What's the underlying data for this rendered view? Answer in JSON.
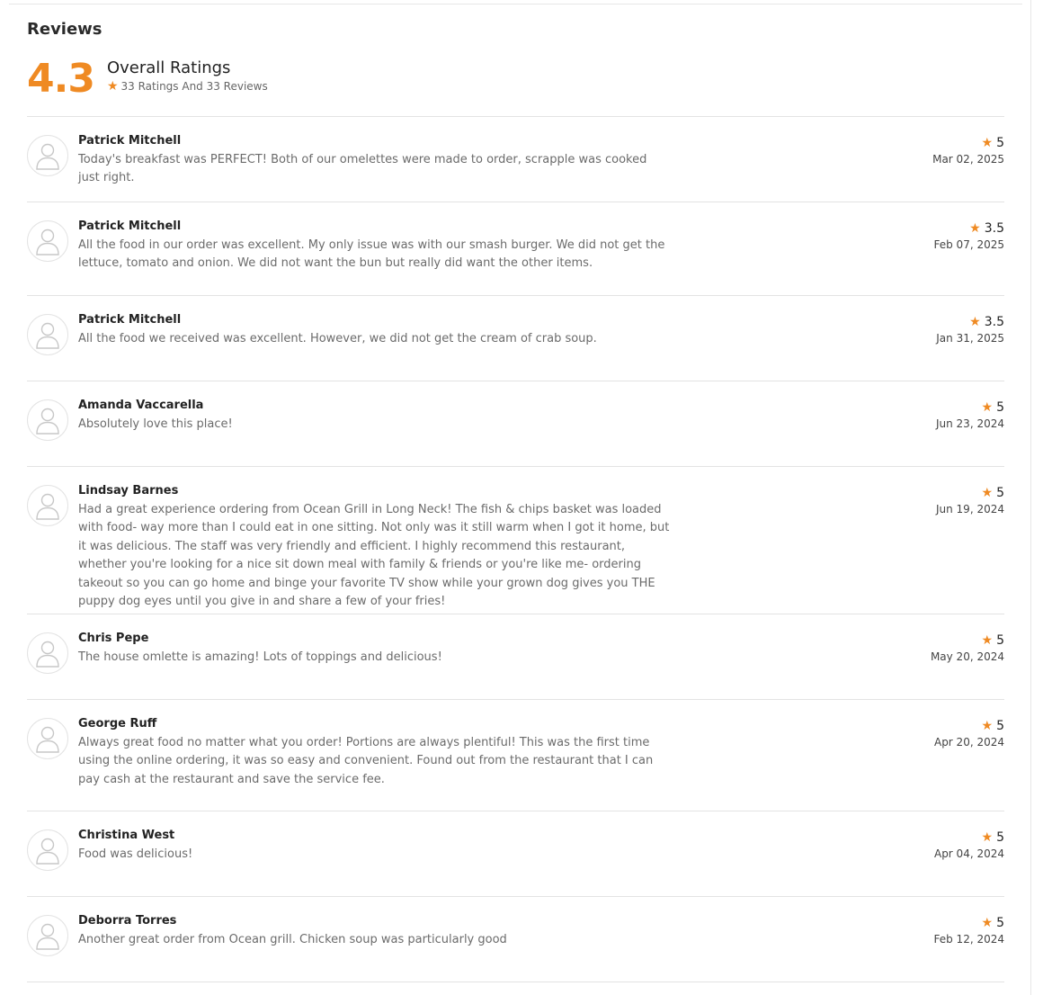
{
  "section": {
    "title": "Reviews"
  },
  "summary": {
    "score": "4.3",
    "title": "Overall Ratings",
    "subtitle": "33 Ratings And 33 Reviews"
  },
  "colors": {
    "accent": "#ef8a23",
    "divider": "#e3e3e3",
    "text_muted": "#6b6b6b"
  },
  "icons": {
    "star": "star-icon",
    "avatar": "user-icon"
  },
  "reviews": [
    {
      "name": "Patrick Mitchell",
      "text": "Today's breakfast was PERFECT! Both of our omelettes were made to order, scrapple was cooked just right.",
      "rating": "5",
      "date": "Mar 02, 2025"
    },
    {
      "name": "Patrick Mitchell",
      "text": "All the food in our order was excellent. My only issue was with our smash burger. We did not get the lettuce, tomato and onion. We did not want the bun but really did want the other items.",
      "rating": "3.5",
      "date": "Feb 07, 2025"
    },
    {
      "name": "Patrick Mitchell",
      "text": "All the food we received was excellent. However, we did not get the cream of crab soup.",
      "rating": "3.5",
      "date": "Jan 31, 2025"
    },
    {
      "name": "Amanda Vaccarella",
      "text": "Absolutely love this place!",
      "rating": "5",
      "date": "Jun 23, 2024"
    },
    {
      "name": "Lindsay Barnes",
      "text": "Had a great experience ordering from Ocean Grill in Long Neck! The fish & chips basket was loaded with food- way more than I could eat in one sitting. Not only was it still warm when I got it home, but it was delicious. The staff was very friendly and efficient. I highly recommend this restaurant, whether you're looking for a nice sit down meal with family & friends or you're like me- ordering takeout so you can go home and binge your favorite TV show while your grown dog gives you THE puppy dog eyes until you give in and share a few of your fries!",
      "rating": "5",
      "date": "Jun 19, 2024"
    },
    {
      "name": "Chris Pepe",
      "text": "The house omlette is amazing! Lots of toppings and delicious!",
      "rating": "5",
      "date": "May 20, 2024"
    },
    {
      "name": "George Ruff",
      "text": "Always great food no matter what you order! Portions are always plentiful! This was the first time using the online ordering, it was so easy and convenient. Found out from the restaurant that I can pay cash at the restaurant and save the service fee.",
      "rating": "5",
      "date": "Apr 20, 2024"
    },
    {
      "name": "Christina West",
      "text": "Food was delicious!",
      "rating": "5",
      "date": "Apr 04, 2024"
    },
    {
      "name": "Deborra Torres",
      "text": "Another great order from Ocean grill. Chicken soup was particularly good",
      "rating": "5",
      "date": "Feb 12, 2024"
    }
  ]
}
